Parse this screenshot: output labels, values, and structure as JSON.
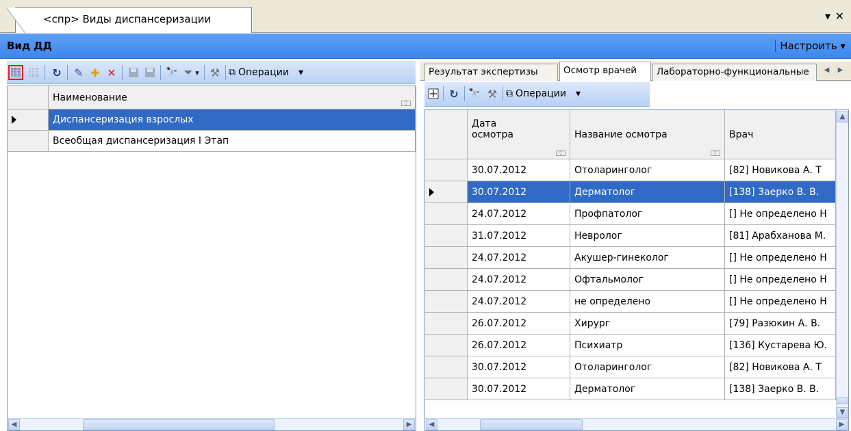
{
  "window": {
    "tab_title": "<спр> Виды диспансеризации",
    "pin_glyph": "▾",
    "close_glyph": "✕"
  },
  "header": {
    "title": "Вид ДД",
    "configure_label": "Настроить",
    "configure_glyph": "▾"
  },
  "left_toolbar": {
    "operations_label": "Операции",
    "dropdown_glyph": "▾"
  },
  "left_grid": {
    "column_header": "Наименование",
    "rows": [
      {
        "name": "Диспансеризация взрослых",
        "selected": true
      },
      {
        "name": "Всеобщая диспансеризация I Этап",
        "selected": false
      }
    ]
  },
  "right_tabs": [
    {
      "label": "Результат экспертизы",
      "active": false
    },
    {
      "label": "Осмотр врачей",
      "active": true
    },
    {
      "label": "Лабораторно-функциональные",
      "active": false
    }
  ],
  "right_toolbar": {
    "operations_label": "Операции",
    "dropdown_glyph": "▾"
  },
  "right_grid": {
    "headers": {
      "date": "Дата осмотра",
      "exam": "Название осмотра",
      "doctor": "Врач"
    },
    "rows": [
      {
        "date": "30.07.2012",
        "exam": "Отоларинголог",
        "doctor": "[82] Новикова А. Т",
        "selected": false
      },
      {
        "date": "30.07.2012",
        "exam": "Дерматолог",
        "doctor": "[138] Заерко В. В.",
        "selected": true
      },
      {
        "date": "24.07.2012",
        "exam": "Профпатолог",
        "doctor": "[] Не определено Н",
        "selected": false
      },
      {
        "date": "31.07.2012",
        "exam": "Невролог",
        "doctor": "[81] Арабханова М.",
        "selected": false
      },
      {
        "date": "24.07.2012",
        "exam": "Акушер-гинеколог",
        "doctor": "[] Не определено Н",
        "selected": false
      },
      {
        "date": "24.07.2012",
        "exam": "Офтальмолог",
        "doctor": "[] Не определено Н",
        "selected": false
      },
      {
        "date": "24.07.2012",
        "exam": "не определено",
        "doctor": "[] Не определено Н",
        "selected": false
      },
      {
        "date": "26.07.2012",
        "exam": "Хирург",
        "doctor": "[79] Разюкин А. В.",
        "selected": false
      },
      {
        "date": "26.07.2012",
        "exam": "Психиатр",
        "doctor": "[136] Кустарева Ю.",
        "selected": false
      },
      {
        "date": "30.07.2012",
        "exam": "Отоларинголог",
        "doctor": "[82] Новикова А. Т",
        "selected": false
      },
      {
        "date": "30.07.2012",
        "exam": "Дерматолог",
        "doctor": "[138] Заерко В. В.",
        "selected": false
      }
    ]
  },
  "colors": {
    "header_blue": "#3e86ee",
    "selection": "#316ac5",
    "toolbar": "#c9dcf7"
  }
}
